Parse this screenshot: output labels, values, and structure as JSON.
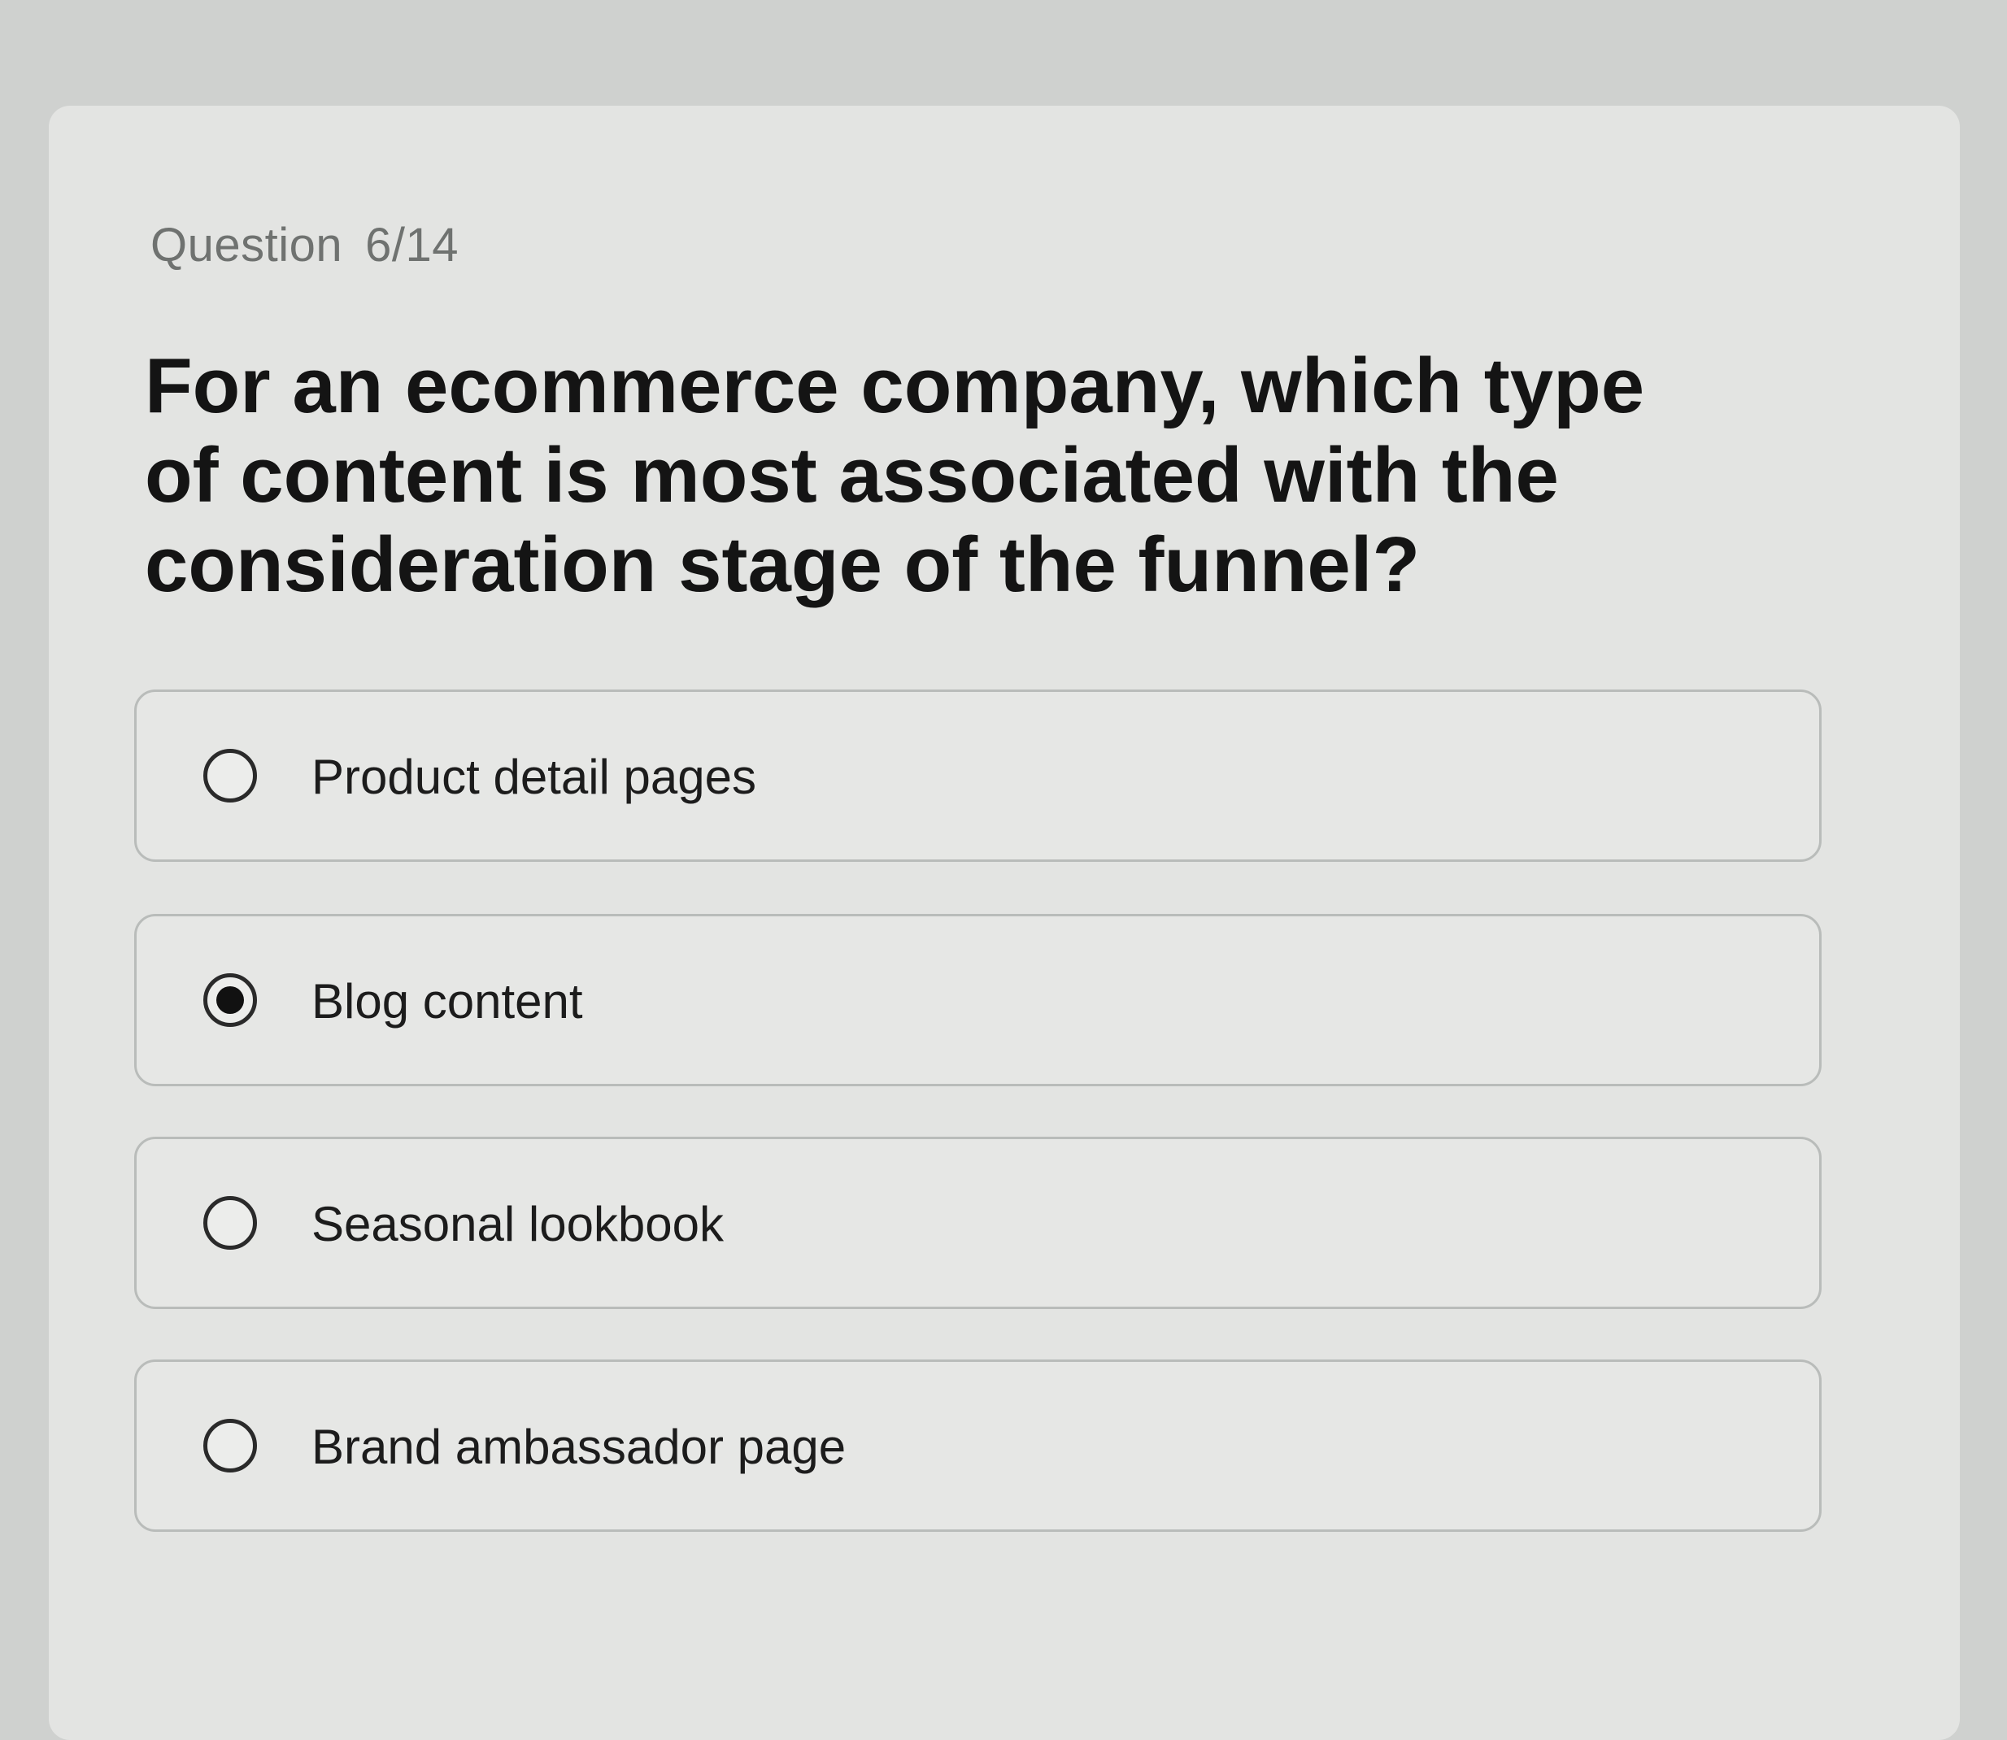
{
  "quiz": {
    "counter_label": "Question",
    "counter_value": "6/14",
    "question": "For an ecommerce company, which type of content is most associated with the consideration stage of the funnel?",
    "options": [
      {
        "label": "Product detail pages",
        "selected": false
      },
      {
        "label": "Blog content",
        "selected": true
      },
      {
        "label": "Seasonal lookbook",
        "selected": false
      },
      {
        "label": "Brand ambassador page",
        "selected": false
      }
    ]
  }
}
